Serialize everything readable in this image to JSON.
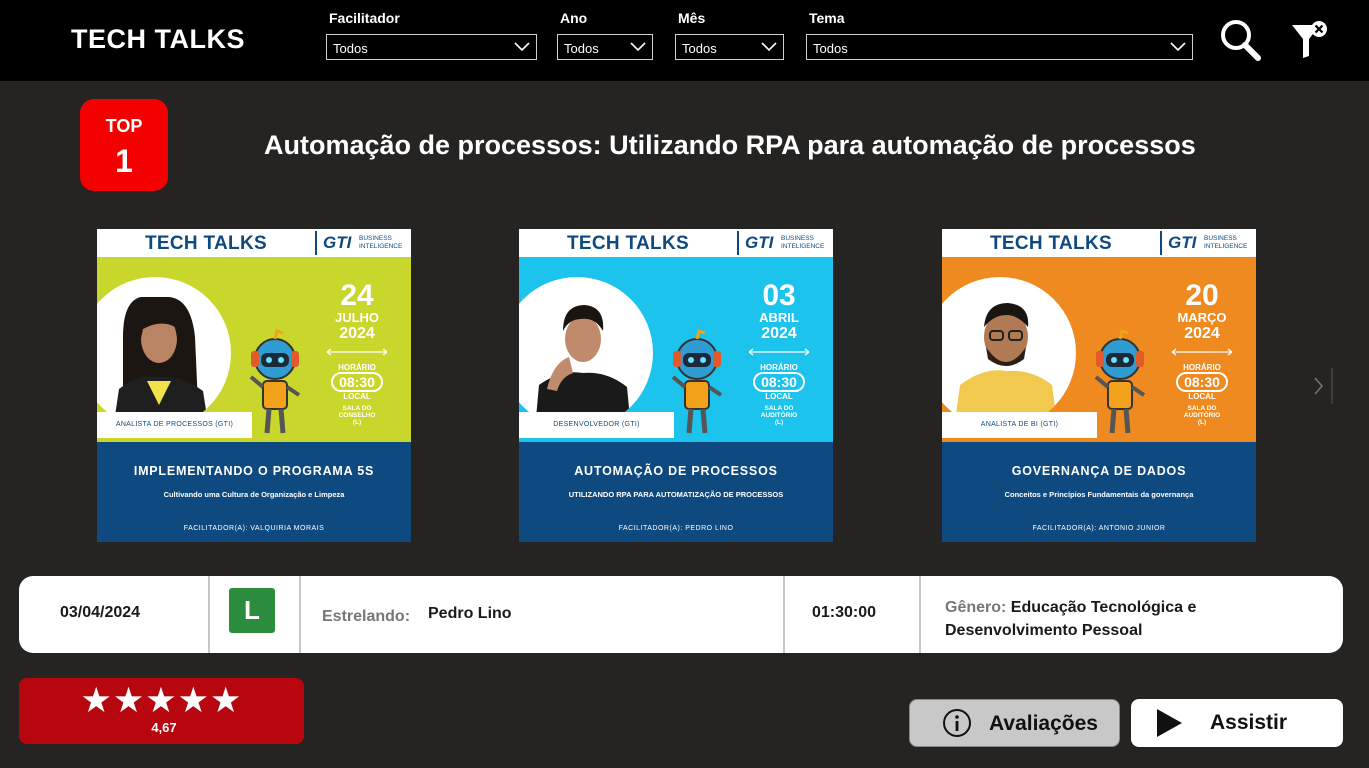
{
  "app": {
    "title": "TECH TALKS"
  },
  "filters": [
    {
      "label": "Facilitador",
      "value": "Todos"
    },
    {
      "label": "Ano",
      "value": "Todos"
    },
    {
      "label": "Mês",
      "value": "Todos"
    },
    {
      "label": "Tema",
      "value": "Todos"
    }
  ],
  "toolbar": {
    "search_icon": "search-icon",
    "clear_filter_icon": "filter-clear-icon"
  },
  "top": {
    "label": "TOP",
    "rank": "1"
  },
  "title": "Automação de processos: Utilizando RPA para automação de processos",
  "cards": [
    {
      "brand": "TECH TALKS",
      "gti": "GTI",
      "bi_line1": "BUSINESS",
      "bi_line2": "INTELIGENCE",
      "day": "24",
      "month": "JULHO",
      "year": "2024",
      "horario_label": "HORÁRIO",
      "time": "08:30",
      "local_label": "LOCAL",
      "room1": "SALA DO",
      "room2": "CONSELHO",
      "room3": "(L)",
      "role": "ANALISTA DE PROCESSOS (GTI)",
      "title": "IMPLEMENTANDO O PROGRAMA 5S",
      "subtitle": "Cultivando uma Cultura de Organização e Limpeza",
      "facilitator": "FACILITADOR(A): VALQUIRIA MORAIS",
      "bg_color": "#c9d62b"
    },
    {
      "brand": "TECH TALKS",
      "gti": "GTI",
      "bi_line1": "BUSINESS",
      "bi_line2": "INTELIGENCE",
      "day": "03",
      "month": "ABRIL",
      "year": "2024",
      "horario_label": "HORÁRIO",
      "time": "08:30",
      "local_label": "LOCAL",
      "room1": "SALA DO",
      "room2": "AUDITÓRIO",
      "room3": "(L)",
      "role": "DESENVOLVEDOR (GTI)",
      "title": "AUTOMAÇÃO DE PROCESSOS",
      "subtitle": "UTILIZANDO RPA PARA AUTOMATIZAÇÃO DE PROCESSOS",
      "facilitator": "FACILITADOR(A): PEDRO LINO",
      "bg_color": "#1cc3ec"
    },
    {
      "brand": "TECH TALKS",
      "gti": "GTI",
      "bi_line1": "BUSINESS",
      "bi_line2": "INTELIGENCE",
      "day": "20",
      "month": "MARÇO",
      "year": "2024",
      "horario_label": "HORÁRIO",
      "time": "08:30",
      "local_label": "LOCAL",
      "room1": "SALA DO",
      "room2": "AUDITÓRIO",
      "room3": "(L)",
      "role": "ANALISTA DE BI (GTI)",
      "title": "GOVERNANÇA DE DADOS",
      "subtitle": "Conceitos e Princípios Fundamentais da governança",
      "facilitator": "FACILITADOR(A): ANTONIO JUNIOR",
      "bg_color": "#ee8a1f"
    }
  ],
  "info": {
    "date": "03/04/2024",
    "age_rating": "L",
    "starring_label": "Estrelando:",
    "starring": "Pedro Lino",
    "duration": "01:30:00",
    "genre_label": "Gênero:",
    "genre_line1": "Educação Tecnológica e",
    "genre_line2": "Desenvolvimento Pessoal"
  },
  "rating": {
    "stars": "★★★★★",
    "score": "4,67",
    "value": 4.67,
    "max": 5
  },
  "buttons": {
    "reviews": "Avaliações",
    "watch": "Assistir"
  },
  "colors": {
    "top_badge": "#f50000",
    "rating_box": "#b8060f",
    "age_l": "#2b8c3e",
    "card_footer": "#0e4a80"
  }
}
